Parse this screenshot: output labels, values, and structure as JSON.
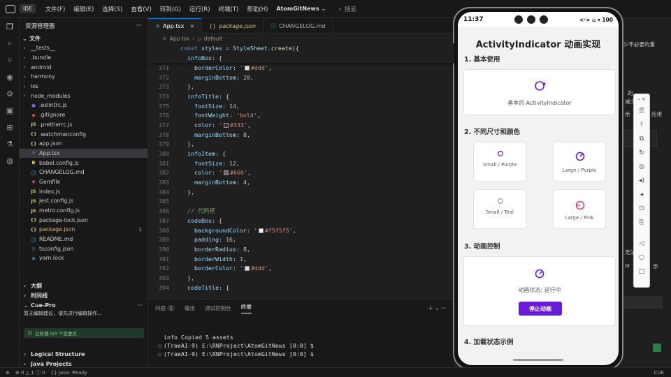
{
  "titlebar": {
    "ide_badge": "IDE",
    "menus": [
      "文件(F)",
      "编辑(E)",
      "选择(S)",
      "查看(V)",
      "转到(G)",
      "运行(R)",
      "终端(T)",
      "帮助(H)"
    ],
    "project": "AtomGitNews",
    "search_placeholder": "搜索"
  },
  "sidebar": {
    "title": "资源管理器",
    "section": "文件",
    "items": [
      {
        "name": "__tests__",
        "type": "folder"
      },
      {
        "name": ".bundle",
        "type": "folder"
      },
      {
        "name": "android",
        "type": "folder"
      },
      {
        "name": "harmony",
        "type": "folder"
      },
      {
        "name": "ios",
        "type": "folder"
      },
      {
        "name": "node_modules",
        "type": "folder"
      },
      {
        "name": ".eslintrc.js",
        "type": "eslint",
        "icon": "●"
      },
      {
        "name": ".gitignore",
        "type": "git",
        "icon": "◆"
      },
      {
        "name": ".prettierrc.js",
        "type": "js",
        "icon": "JS"
      },
      {
        "name": ".watchmanconfig",
        "type": "json",
        "icon": "{}"
      },
      {
        "name": "app.json",
        "type": "json",
        "icon": "{}"
      },
      {
        "name": "App.tsx",
        "type": "tsx",
        "icon": "⚛"
      },
      {
        "name": "babel.config.js",
        "type": "babel",
        "icon": "B"
      },
      {
        "name": "CHANGELOG.md",
        "type": "md",
        "icon": "ⓘ"
      },
      {
        "name": "Gemfile",
        "type": "gem",
        "icon": "◆"
      },
      {
        "name": "index.js",
        "type": "js",
        "icon": "JS"
      },
      {
        "name": "jest.config.js",
        "type": "js",
        "icon": "JS"
      },
      {
        "name": "metro.config.js",
        "type": "js",
        "icon": "JS"
      },
      {
        "name": "package-lock.json",
        "type": "json",
        "icon": "{}"
      },
      {
        "name": "package.json",
        "type": "json",
        "icon": "{}",
        "badge": "1"
      },
      {
        "name": "README.md",
        "type": "md",
        "icon": "ⓘ"
      },
      {
        "name": "tsconfig.json",
        "type": "tsconfig",
        "icon": "◎"
      },
      {
        "name": "yarn.lock",
        "type": "yarn",
        "icon": "◉"
      }
    ],
    "outline": "大纲",
    "timeline": "时间线",
    "cue_title": "Cue-Pro",
    "cue_msg": "暂无编辑建议，请先进行编辑操作...",
    "cue_status": "已处理 0/0 个变更点",
    "logical_structure": "Logical Structure",
    "java_projects": "Java Projects"
  },
  "editor": {
    "tabs": [
      {
        "label": "App.tsx",
        "icon": "⚛"
      },
      {
        "label": "package.json",
        "icon": "{}"
      },
      {
        "label": "CHANGELOG.md",
        "icon": "ⓘ"
      }
    ],
    "breadcrumb": [
      "App.tsx",
      "default"
    ],
    "sticky": [
      "const styles = StyleSheet.create({",
      "  infoBox: {"
    ],
    "lines": [
      {
        "n": "371",
        "t": "    borderColor: '",
        "v": "#ddd",
        "e": "',",
        "sw": "#dddddd"
      },
      {
        "n": "372",
        "t": "    marginBottom: 20,"
      },
      {
        "n": "373",
        "t": "  },"
      },
      {
        "n": "374",
        "t": "  infoTitle: {"
      },
      {
        "n": "375",
        "t": "    fontSize: 14,"
      },
      {
        "n": "376",
        "t": "    fontWeight: 'bold',"
      },
      {
        "n": "377",
        "t": "    color: '",
        "v": "#333",
        "e": "',",
        "sw": "#333333"
      },
      {
        "n": "378",
        "t": "    marginBottom: 8,"
      },
      {
        "n": "379",
        "t": "  },"
      },
      {
        "n": "380",
        "t": "  infoItem: {"
      },
      {
        "n": "381",
        "t": "    fontSize: 12,"
      },
      {
        "n": "382",
        "t": "    color: '",
        "v": "#666",
        "e": "',",
        "sw": "#666666"
      },
      {
        "n": "383",
        "t": "    marginBottom: 4,"
      },
      {
        "n": "384",
        "t": "  },"
      },
      {
        "n": "385",
        "t": ""
      },
      {
        "n": "386",
        "t": "  // 代码框"
      },
      {
        "n": "387",
        "t": "  codeBox: {"
      },
      {
        "n": "388",
        "t": "    backgroundColor: '",
        "v": "#f5f5f5",
        "e": "',",
        "sw": "#f5f5f5"
      },
      {
        "n": "389",
        "t": "    padding: 16,"
      },
      {
        "n": "390",
        "t": "    borderRadius: 8,"
      },
      {
        "n": "391",
        "t": "    borderWidth: 1,"
      },
      {
        "n": "392",
        "t": "    borderColor: '",
        "v": "#ddd",
        "e": "',",
        "sw": "#dddddd"
      },
      {
        "n": "393",
        "t": "  },"
      },
      {
        "n": "394",
        "t": "  codeTitle: {"
      }
    ]
  },
  "panel": {
    "tabs": [
      "问题",
      "输出",
      "调试控制台",
      "终端"
    ],
    "problems_count": "1",
    "terminal": [
      "info Copied 5 assets",
      "(TraeAI-9) E:\\RNProject\\AtomGitNews [0:0] $",
      "(TraeAI-9) E:\\RNProject\\AtomGitNews [0:0] $"
    ]
  },
  "statusbar": {
    "errors": "0",
    "warnings": "1",
    "info": "0",
    "java": "Java: Ready",
    "right": "CUE"
  },
  "right_bg_text": [
    "少不必要的重",
    "的",
    "减少",
    "示",
    "应用",
    "无法",
    "or",
    "示"
  ],
  "phone": {
    "time": "11:37",
    "sb_icons": "<·> ⌂ ▾ 100",
    "title": "ActivityIndicator 动画实现",
    "sections": [
      "1. 基本使用",
      "2. 不同尺寸和颜色",
      "3. 动画控制",
      "4. 加载状态示例"
    ],
    "basic_caption": "基本的 ActivityIndicator",
    "sizes": [
      {
        "label": "Small / Purple",
        "color": "#6a1bd6"
      },
      {
        "label": "Large / Purple",
        "color": "#6a1bd6"
      },
      {
        "label": "Small / Teal",
        "color": "#9e9e9e"
      },
      {
        "label": "Large / Pink",
        "color": "#e0455f"
      }
    ],
    "control_status": "动画状态: 运行中",
    "control_button": "停止动画"
  },
  "colors": {
    "accent": "#0078d4",
    "purple": "#6a1bd6"
  }
}
